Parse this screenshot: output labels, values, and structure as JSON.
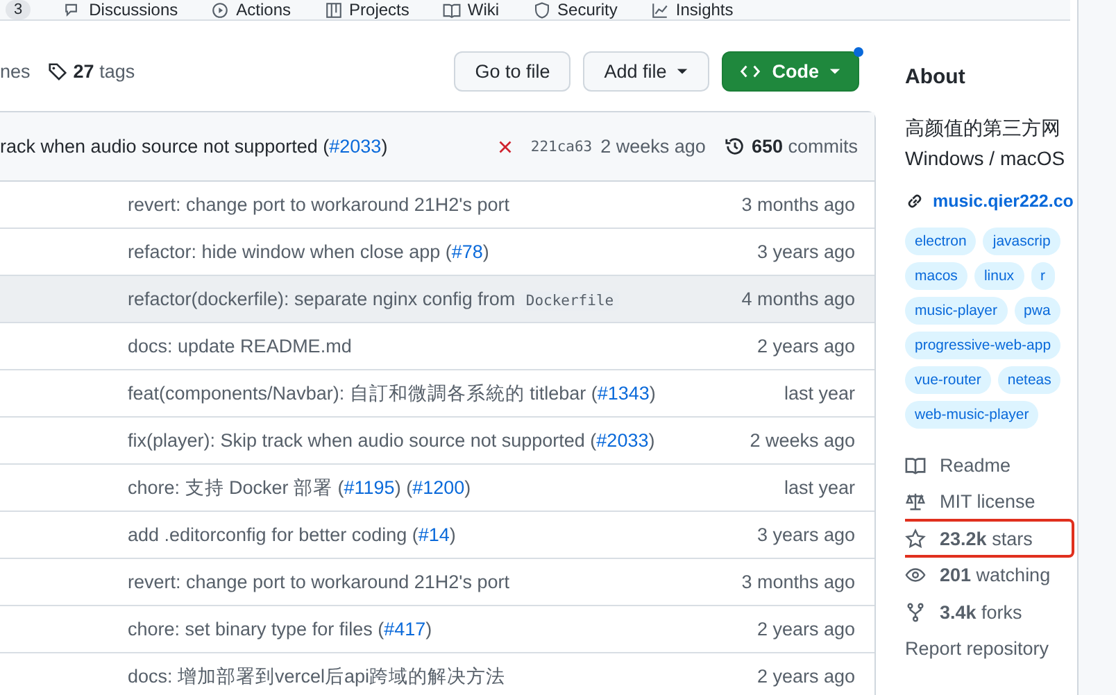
{
  "nav": {
    "items": [
      {
        "label": "3",
        "kind": "count"
      },
      {
        "label": "Discussions",
        "kind": "discussions"
      },
      {
        "label": "Actions",
        "kind": "actions"
      },
      {
        "label": "Projects",
        "kind": "projects"
      },
      {
        "label": "Wiki",
        "kind": "wiki"
      },
      {
        "label": "Security",
        "kind": "security"
      },
      {
        "label": "Insights",
        "kind": "insights"
      }
    ]
  },
  "toolbar": {
    "branches": "nes",
    "tags_count": "27",
    "tags_label": "tags",
    "buttons": [
      {
        "label": "Go to file",
        "kind": "plain"
      },
      {
        "label": "Add file",
        "kind": "dropdown"
      },
      {
        "label": "Code",
        "kind": "primary"
      }
    ],
    "code_notification": true
  },
  "latest_commit": {
    "message": [
      {
        "kind": "text",
        "text": "rack when audio source not supported ("
      },
      {
        "kind": "link",
        "text": "#2033"
      },
      {
        "kind": "text",
        "text": ")"
      }
    ],
    "ci_failed": true,
    "sha": "221ca63",
    "time": "2 weeks ago",
    "commits_count": "650",
    "commits_label": "commits"
  },
  "rows": [
    {
      "message": [
        {
          "kind": "text",
          "text": "revert: change port to workaround 21H2's port"
        }
      ],
      "time": "3 months ago",
      "highlighted": false
    },
    {
      "message": [
        {
          "kind": "text",
          "text": "refactor: hide window when close app ("
        },
        {
          "kind": "link",
          "text": "#78"
        },
        {
          "kind": "text",
          "text": ")"
        }
      ],
      "time": "3 years ago",
      "highlighted": false
    },
    {
      "message": [
        {
          "kind": "text",
          "text": "refactor(dockerfile): separate nginx config from "
        },
        {
          "kind": "code",
          "text": "Dockerfile"
        }
      ],
      "time": "4 months ago",
      "highlighted": true
    },
    {
      "message": [
        {
          "kind": "text",
          "text": "docs: update README.md"
        }
      ],
      "time": "2 years ago",
      "highlighted": false
    },
    {
      "message": [
        {
          "kind": "text",
          "text": "feat(components/Navbar): 自訂和微調各系統的 titlebar ("
        },
        {
          "kind": "link",
          "text": "#1343"
        },
        {
          "kind": "text",
          "text": ")"
        }
      ],
      "time": "last year",
      "highlighted": false
    },
    {
      "message": [
        {
          "kind": "text",
          "text": "fix(player): Skip track when audio source not supported ("
        },
        {
          "kind": "link",
          "text": "#2033"
        },
        {
          "kind": "text",
          "text": ")"
        }
      ],
      "time": "2 weeks ago",
      "highlighted": false
    },
    {
      "message": [
        {
          "kind": "text",
          "text": "chore: 支持 Docker 部署 ("
        },
        {
          "kind": "link",
          "text": "#1195"
        },
        {
          "kind": "text",
          "text": ") ("
        },
        {
          "kind": "link",
          "text": "#1200"
        },
        {
          "kind": "text",
          "text": ")"
        }
      ],
      "time": "last year",
      "highlighted": false
    },
    {
      "message": [
        {
          "kind": "text",
          "text": "add .editorconfig for better coding ("
        },
        {
          "kind": "link",
          "text": "#14"
        },
        {
          "kind": "text",
          "text": ")"
        }
      ],
      "time": "3 years ago",
      "highlighted": false
    },
    {
      "message": [
        {
          "kind": "text",
          "text": "revert: change port to workaround 21H2's port"
        }
      ],
      "time": "3 months ago",
      "highlighted": false
    },
    {
      "message": [
        {
          "kind": "text",
          "text": "chore: set binary type for files ("
        },
        {
          "kind": "link",
          "text": "#417"
        },
        {
          "kind": "text",
          "text": ")"
        }
      ],
      "time": "2 years ago",
      "highlighted": false
    },
    {
      "message": [
        {
          "kind": "text",
          "text": "docs: 增加部署到vercel后api跨域的解决方法"
        }
      ],
      "time": "2 years ago",
      "highlighted": false
    }
  ],
  "about": {
    "title": "About",
    "description": [
      "高颜值的第三方网",
      "Windows / macOS"
    ],
    "link": "music.qier222.co",
    "topics": [
      [
        "electron",
        "javascrip"
      ],
      [
        "macos",
        "linux",
        "r"
      ],
      [
        "music-player",
        "pwa"
      ],
      [
        "progressive-web-app"
      ],
      [
        "vue-router",
        "neteas"
      ],
      [
        "web-music-player"
      ]
    ],
    "stats": [
      {
        "kind": "readme",
        "label": "Readme",
        "highlighted": false
      },
      {
        "kind": "license",
        "label": "MIT license",
        "highlighted": false
      },
      {
        "kind": "stars",
        "count": "23.2k",
        "label": "stars",
        "highlighted": true
      },
      {
        "kind": "watching",
        "count": "201",
        "label": "watching",
        "highlighted": false
      },
      {
        "kind": "forks",
        "count": "3.4k",
        "label": "forks",
        "highlighted": false
      },
      {
        "kind": "report",
        "label": "Report repository",
        "highlighted": false
      }
    ]
  }
}
